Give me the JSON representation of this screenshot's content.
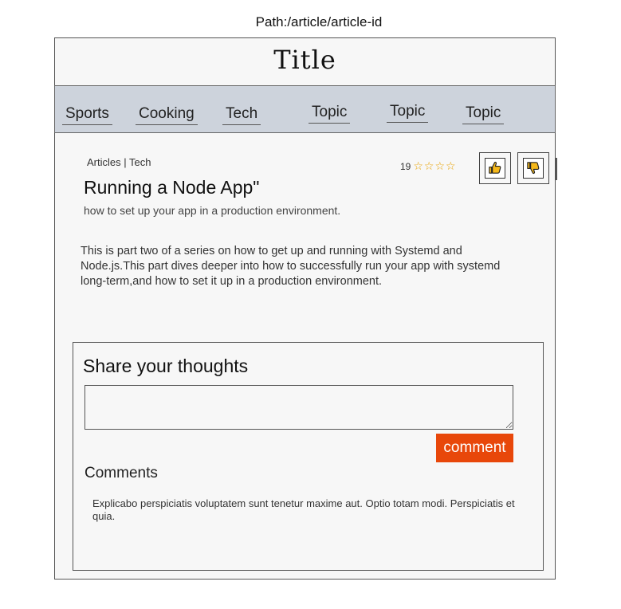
{
  "path": "Path:/article/article-id",
  "title": "Title",
  "nav": {
    "items": [
      {
        "label": "Sports"
      },
      {
        "label": "Cooking"
      },
      {
        "label": "Tech"
      },
      {
        "label": "Topic"
      },
      {
        "label": "Topic"
      },
      {
        "label": "Topic"
      }
    ]
  },
  "article": {
    "breadcrumb": "Articles | Tech",
    "title": "Running a Node App\"",
    "subtitle": "how to set  up your app in a production environment.",
    "rating_count": "19",
    "stars": "☆☆☆☆",
    "star_count": 4,
    "body": "This is part two of a series on how to get up and running with Systemd and Node.js.This part dives deeper into how to successfully run your app with systemd long-term,and how to set it up in a production environment."
  },
  "vote": {
    "up_icon": "thumbs-up-icon",
    "down_icon": "thumbs-down-icon",
    "icon_color": "#f5b81a"
  },
  "share": {
    "heading": "Share your thoughts",
    "input_value": "",
    "button_label": "comment",
    "button_color": "#e8470a"
  },
  "comments": {
    "heading": "Comments",
    "items": [
      {
        "text": "Explicabo perspiciatis voluptatem sunt tenetur maxime aut. Optio totam modi. Perspiciatis et quia."
      }
    ]
  }
}
